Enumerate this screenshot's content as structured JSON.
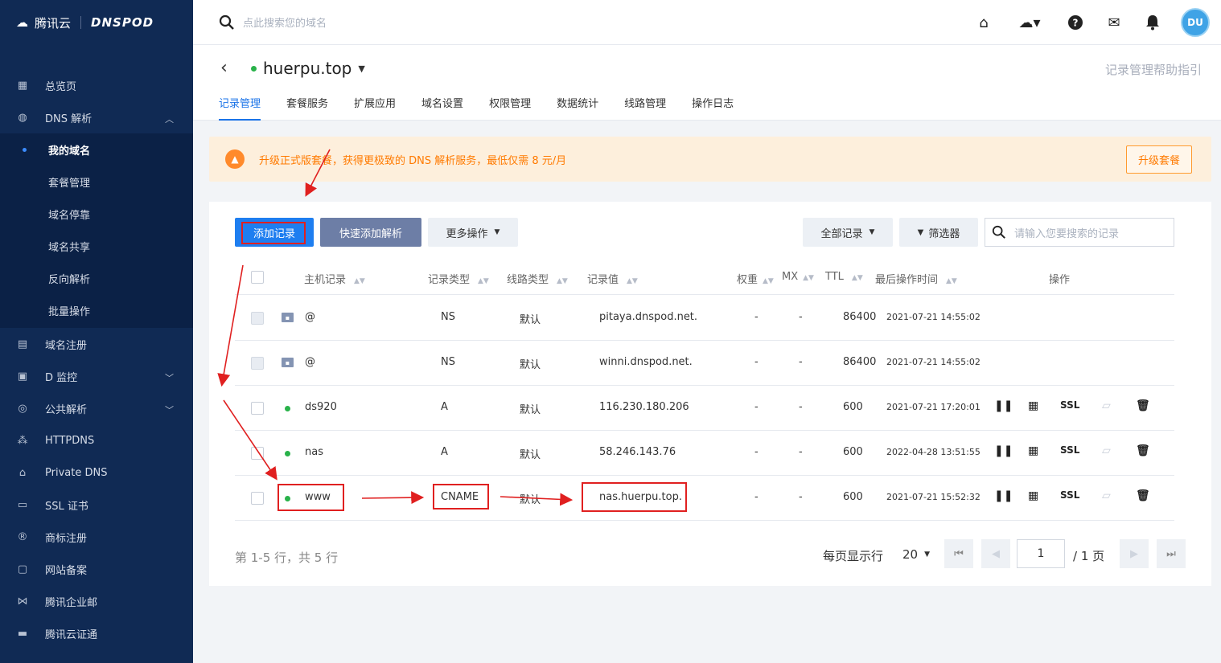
{
  "sidebar": {
    "logo_text": "腾讯云",
    "logo_brand": "DNSPOD",
    "items": [
      {
        "label": "总览页",
        "icon": "grid-icon"
      },
      {
        "label": "DNS 解析",
        "icon": "globe-icon"
      },
      {
        "label": "域名注册",
        "icon": "calendar-icon"
      },
      {
        "label": "D 监控",
        "icon": "monitor-icon"
      },
      {
        "label": "公共解析",
        "icon": "public-dns-icon"
      },
      {
        "label": "HTTPDNS",
        "icon": "nodes-icon"
      },
      {
        "label": "Private DNS",
        "icon": "private-dns-icon"
      },
      {
        "label": "SSL 证书",
        "icon": "certificate-icon"
      },
      {
        "label": "商标注册",
        "icon": "trademark-icon"
      },
      {
        "label": "网站备案",
        "icon": "record-icon"
      },
      {
        "label": "腾讯企业邮",
        "icon": "mail-icon"
      },
      {
        "label": "腾讯云证通",
        "icon": "id-card-icon"
      }
    ],
    "dns_sub": [
      "我的域名",
      "套餐管理",
      "域名停靠",
      "域名共享",
      "反向解析",
      "批量操作"
    ]
  },
  "topbar": {
    "search_placeholder": "点此搜索您的域名",
    "avatar_text": "DU"
  },
  "domain": {
    "name": "huerpu.top",
    "help_link": "记录管理帮助指引",
    "tabs": [
      "记录管理",
      "套餐服务",
      "扩展应用",
      "域名设置",
      "权限管理",
      "数据统计",
      "线路管理",
      "操作日志"
    ]
  },
  "banner": {
    "text": "升级正式版套餐，获得更极致的 DNS 解析服务，最低仅需 8 元/月",
    "button": "升级套餐"
  },
  "toolbar": {
    "add_record": "添加记录",
    "quick_add": "快速添加解析",
    "more_ops": "更多操作",
    "all_records": "全部记录",
    "filter": "筛选器",
    "search_placeholder": "请输入您要搜索的记录"
  },
  "table": {
    "headers": {
      "host": "主机记录",
      "type": "记录类型",
      "line": "线路类型",
      "value": "记录值",
      "weight": "权重",
      "mx": "MX",
      "ttl": "TTL",
      "time": "最后操作时间",
      "ops": "操作"
    },
    "rows": [
      {
        "host": "@",
        "type": "NS",
        "line": "默认",
        "value": "pitaya.dnspod.net.",
        "weight": "-",
        "mx": "-",
        "ttl": "86400",
        "time": "2021-07-21 14:55:02"
      },
      {
        "host": "@",
        "type": "NS",
        "line": "默认",
        "value": "winni.dnspod.net.",
        "weight": "-",
        "mx": "-",
        "ttl": "86400",
        "time": "2021-07-21 14:55:02"
      },
      {
        "host": "ds920",
        "type": "A",
        "line": "默认",
        "value": "116.230.180.206",
        "weight": "-",
        "mx": "-",
        "ttl": "600",
        "time": "2021-07-21 17:20:01"
      },
      {
        "host": "nas",
        "type": "A",
        "line": "默认",
        "value": "58.246.143.76",
        "weight": "-",
        "mx": "-",
        "ttl": "600",
        "time": "2022-04-28 13:51:55"
      },
      {
        "host": "www",
        "type": "CNAME",
        "line": "默认",
        "value": "nas.huerpu.top.",
        "weight": "-",
        "mx": "-",
        "ttl": "600",
        "time": "2021-07-21 15:52:32"
      }
    ],
    "ssl_label": "SSL"
  },
  "pager": {
    "summary": "第 1-5 行，共 5 行",
    "per_page_label": "每页显示行",
    "per_page": "20",
    "current": "1",
    "total": "/ 1 页"
  }
}
